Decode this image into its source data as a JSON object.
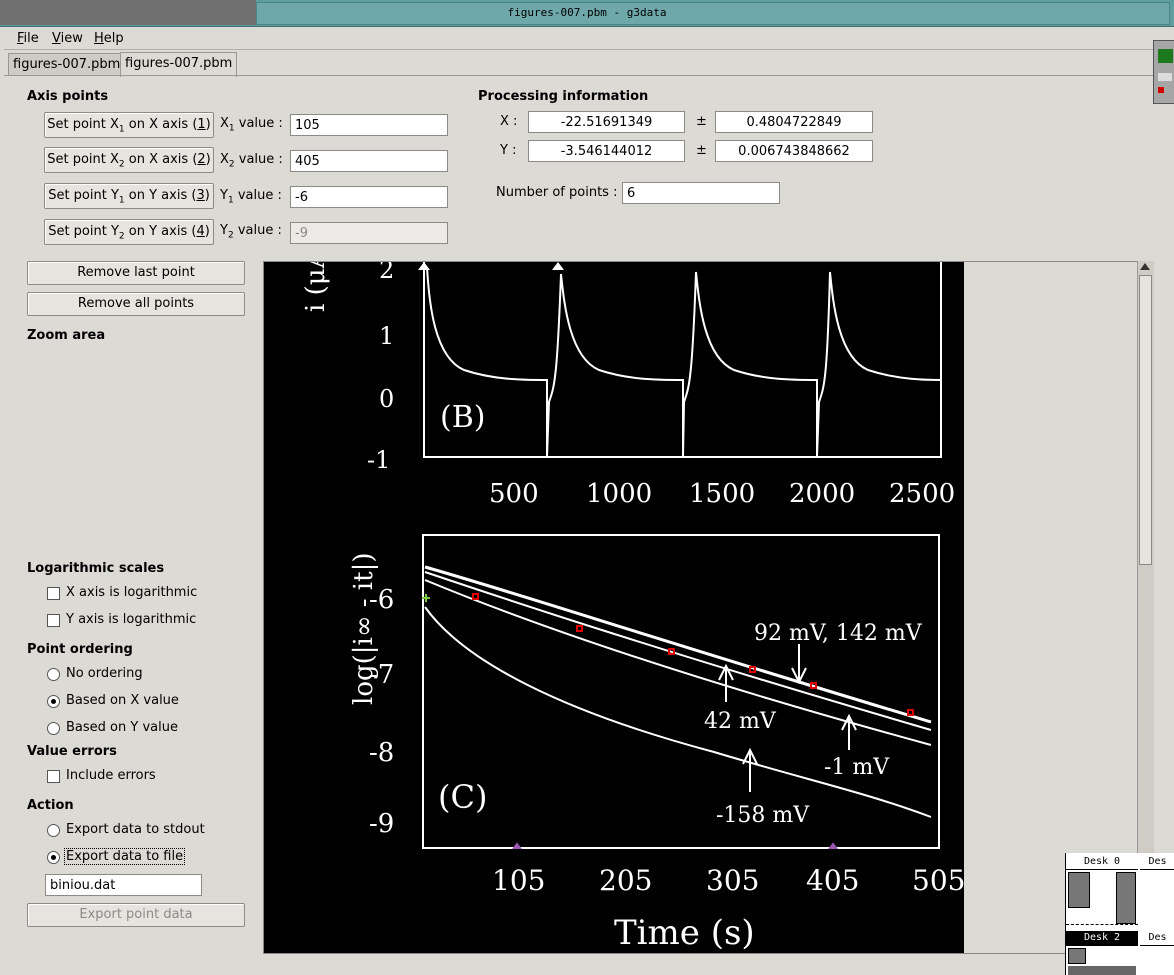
{
  "window": {
    "title": "figures-007.pbm - g3data"
  },
  "menu": [
    {
      "label": "File",
      "mnemonic": "F",
      "rest": "ile"
    },
    {
      "label": "View",
      "mnemonic": "V",
      "rest": "iew"
    },
    {
      "label": "Help",
      "mnemonic": "H",
      "rest": "elp"
    }
  ],
  "tabs": [
    "figures-007.pbm",
    "figures-007.pbm"
  ],
  "axis_points": {
    "title": "Axis points",
    "buttons": [
      "Set point X1 on X axis (1)",
      "Set point X2 on X axis (2)",
      "Set point Y1 on Y axis (3)",
      "Set point Y2 on Y axis (4)"
    ],
    "labels": [
      "X1 value :",
      "X2 value :",
      "Y1 value :",
      "Y2 value :"
    ],
    "values": [
      "105",
      "405",
      "-6",
      "-9"
    ]
  },
  "processing": {
    "title": "Processing information",
    "x_label": "X :",
    "x_value": "-22.51691349",
    "x_error": "0.4804722849",
    "y_label": "Y :",
    "y_value": "-3.546144012",
    "y_error": "0.006743848662",
    "pm": "±",
    "num_points_label": "Number of points :",
    "num_points": "6"
  },
  "buttons": {
    "remove_last": "Remove last point",
    "remove_all": "Remove all points",
    "export": "Export point data"
  },
  "zoom_area": "Zoom area",
  "log_scales": {
    "title": "Logarithmic scales",
    "x": "X axis is logarithmic",
    "y": "Y axis is logarithmic",
    "x_checked": false,
    "y_checked": false
  },
  "point_ordering": {
    "title": "Point ordering",
    "options": [
      "No ordering",
      "Based on X value",
      "Based on Y value"
    ],
    "selected": "Based on X value"
  },
  "value_errors": {
    "title": "Value errors",
    "include": "Include errors"
  },
  "action": {
    "title": "Action",
    "options": [
      "Export data to stdout",
      "Export data to file"
    ],
    "selected": "Export data to file",
    "filename": "biniou.dat"
  },
  "figure": {
    "panel_b": {
      "label": "(B)",
      "ylabel": "i (μA)",
      "yticks": [
        "2",
        "1",
        "0",
        "-1"
      ],
      "xticks": [
        "500",
        "1000",
        "1500",
        "2000",
        "2500"
      ]
    },
    "panel_c": {
      "label": "(C)",
      "ylabel": "log(|i∞ - it|)",
      "yticks": [
        "-6",
        "-7",
        "-8",
        "-9"
      ],
      "xticks": [
        "105",
        "205",
        "305",
        "405",
        "505"
      ],
      "xlabel": "Time (s)",
      "annotations": [
        "92 mV, 142 mV",
        "42 mV",
        "-1 mV",
        "-158 mV"
      ]
    }
  },
  "pager": {
    "desks": [
      "Desk 0",
      "Des",
      "Desk 2",
      "Des"
    ]
  }
}
